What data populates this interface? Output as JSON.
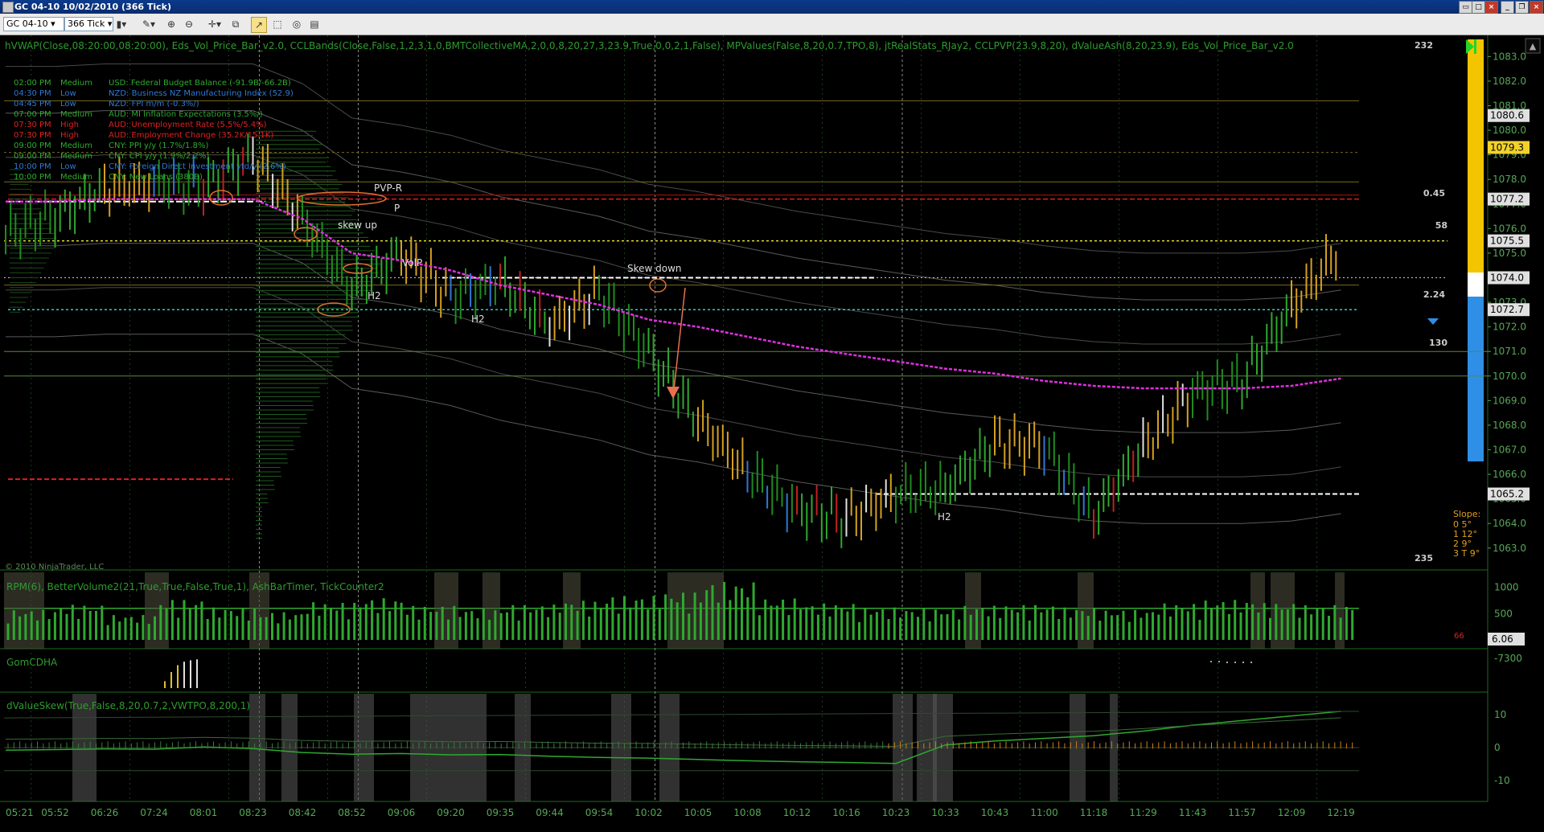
{
  "window": {
    "title": "GC 04-10  10/02/2010 (366 Tick)"
  },
  "toolbar": {
    "instrument": "GC 04-10",
    "interval": "366 Tick"
  },
  "panel1": {
    "indicators": "hVWAP(Close,08:20:00,08:20:00), Eds_Vol_Price_Bar_v2.0, CCLBands(Close,False,1,2,3,1,0,BMTCollectiveMA,2,0,0,8,20,27,3,23.9,True,0,0,2,1,False), MPValues(False,8,20,0.7,TPO,8), jtRealStats_RJay2, CCLPVP(23.9,8,20), dValueAsh(8,20,23.9), Eds_Vol_Price_Bar_v2.0",
    "copyright": "© 2010 NinjaTrader, LLC",
    "top_right_value": "232",
    "bottom_right_value": "235",
    "side_numbers": [
      "0.45",
      "58",
      "2.24",
      "130"
    ],
    "slope": {
      "title": "Slope:",
      "rows": [
        "0  5°",
        "1  12°",
        "2  9°",
        "3 T  9°"
      ]
    },
    "annotations": [
      "PVP-R",
      "P",
      "skew up",
      "VolP",
      "H2",
      "H2",
      "Skew down",
      "H2"
    ],
    "price_ticks": [
      "1083.0",
      "1082.0",
      "1081.0",
      "1080.0",
      "1079.0",
      "1078.0",
      "1077.0",
      "1076.0",
      "1075.0",
      "1074.0",
      "1073.0",
      "1072.0",
      "1071.0",
      "1070.0",
      "1069.0",
      "1068.0",
      "1067.0",
      "1066.0",
      "1065.0",
      "1064.0",
      "1063.0"
    ],
    "price_boxes": [
      {
        "label": "1080.6",
        "color": "#e0e0e0"
      },
      {
        "label": "1079.3",
        "color": "#f2d22a"
      },
      {
        "label": "1077.2",
        "color": "#e0e0e0"
      },
      {
        "label": "1075.5",
        "color": "#e0e0e0"
      },
      {
        "label": "1074.0",
        "color": "#e0e0e0"
      },
      {
        "label": "1072.7",
        "color": "#e0e0e0"
      },
      {
        "label": "1065.2",
        "color": "#e0e0e0"
      }
    ],
    "news": [
      {
        "time": "02:00 PM",
        "impact": "Medium",
        "text": "USD: Federal Budget Balance (-91.9B/-66.2B)"
      },
      {
        "time": "04:30 PM",
        "impact": "Low",
        "text": "NZD: Business NZ Manufacturing Index (52.9)"
      },
      {
        "time": "04:45 PM",
        "impact": "Low",
        "text": "NZD: FPI m/m (-0.3%/)"
      },
      {
        "time": "07:00 PM",
        "impact": "Medium",
        "text": "AUD: MI Inflation Expectations (3.5%/)"
      },
      {
        "time": "07:30 PM",
        "impact": "High",
        "text": "AUD: Unemployment Rate (5.5%/5.4%)"
      },
      {
        "time": "07:30 PM",
        "impact": "High",
        "text": "AUD: Employment Change (35.2K/15.1K)"
      },
      {
        "time": "09:00 PM",
        "impact": "Medium",
        "text": "CNY: PPI y/y (1.7%/1.8%)"
      },
      {
        "time": "09:00 PM",
        "impact": "Medium",
        "text": "CNY: CPI y/y (1.9%/2.2%)"
      },
      {
        "time": "10:00 PM",
        "impact": "Low",
        "text": "CNY: Foreign Direct Investment ytd/y (2.6%)"
      },
      {
        "time": "10:00 PM",
        "impact": "Medium",
        "text": "CNY: New Loans (380B)"
      }
    ]
  },
  "panel2": {
    "label": "RPM(6), BetterVolume2(21,True,True,False,True,1), AshBarTimer, TickCounter2",
    "ticks": [
      "1000",
      "500"
    ],
    "value_box": "6.06",
    "counter": "66"
  },
  "panel3": {
    "label": "GomCDHA",
    "ticks": [
      "-7300"
    ]
  },
  "panel4": {
    "label": "dValueSkew(True,False,8,20,0.7,2,VWTPO,8,200,1)",
    "ticks": [
      "10",
      "0",
      "-10"
    ]
  },
  "time_axis": [
    "05:21",
    "05:52",
    "06:26",
    "07:24",
    "08:01",
    "08:23",
    "08:42",
    "08:52",
    "09:06",
    "09:20",
    "09:35",
    "09:44",
    "09:54",
    "10:02",
    "10:05",
    "10:08",
    "10:12",
    "10:16",
    "10:23",
    "10:33",
    "10:43",
    "11:00",
    "11:18",
    "11:29",
    "11:43",
    "11:57",
    "12:09",
    "12:19"
  ],
  "chart_data": {
    "type": "line",
    "title": "GC 04-10  10/02/2010 (366 Tick)",
    "x": [
      "05:21",
      "05:52",
      "06:26",
      "07:24",
      "08:01",
      "08:23",
      "08:42",
      "08:52",
      "09:06",
      "09:20",
      "09:35",
      "09:44",
      "09:54",
      "10:02",
      "10:05",
      "10:08",
      "10:12",
      "10:16",
      "10:23",
      "10:33",
      "10:43",
      "11:00",
      "11:18",
      "11:29",
      "11:43",
      "11:57",
      "12:09",
      "12:19"
    ],
    "series": [
      {
        "values": [
          1075.8,
          1076.5,
          1077.6,
          1077.8,
          1077.7,
          1079.0,
          1076.4,
          1073.5,
          1075.0,
          1073.2,
          1073.8,
          1072.0,
          1073.4,
          1071.0,
          1068.2,
          1066.1,
          1064.6,
          1064.2,
          1065.2,
          1065.4,
          1067.3,
          1067.2,
          1064.3,
          1067.1,
          1069.3,
          1069.8,
          1072.8,
          1075.2
        ]
      },
      {
        "values": [
          1077.1,
          1077.1,
          1077.2,
          1077.2,
          1077.2,
          1077.2,
          1076.4,
          1075.0,
          1074.7,
          1074.3,
          1073.7,
          1073.3,
          1072.9,
          1072.3,
          1072.0,
          1071.6,
          1071.2,
          1070.9,
          1070.6,
          1070.3,
          1070.1,
          1069.8,
          1069.6,
          1069.5,
          1069.5,
          1069.5,
          1069.6,
          1069.9
        ]
      }
    ],
    "ylim": [
      1062.6,
      1083.6
    ],
    "levels": {
      "red": 1077.2,
      "yellow": 1075.5,
      "white_dashed": 1074.0,
      "cyan": 1072.7,
      "green_upper": 1071.0,
      "green_lower": 1070.0
    },
    "volume": [
      520,
      610,
      430,
      700,
      560,
      480,
      650,
      720,
      590,
      540,
      610,
      680,
      760,
      830,
      1000,
      720,
      630,
      560,
      540,
      590,
      610,
      560,
      520,
      630,
      690,
      640,
      600,
      560
    ],
    "skew": [
      -0.8,
      -0.6,
      -0.4,
      -0.5,
      0.2,
      -0.3,
      -1.5,
      -2.0,
      -1.8,
      -2.2,
      -2.1,
      -2.6,
      -3.0,
      -3.2,
      -3.6,
      -4.0,
      -4.3,
      -4.5,
      -4.8,
      0.8,
      2.0,
      2.8,
      3.6,
      5.0,
      6.8,
      8.2,
      9.6,
      11.0
    ],
    "cdha": [
      -7500,
      -7420,
      -7360,
      -7330,
      -7318,
      -7310
    ]
  }
}
